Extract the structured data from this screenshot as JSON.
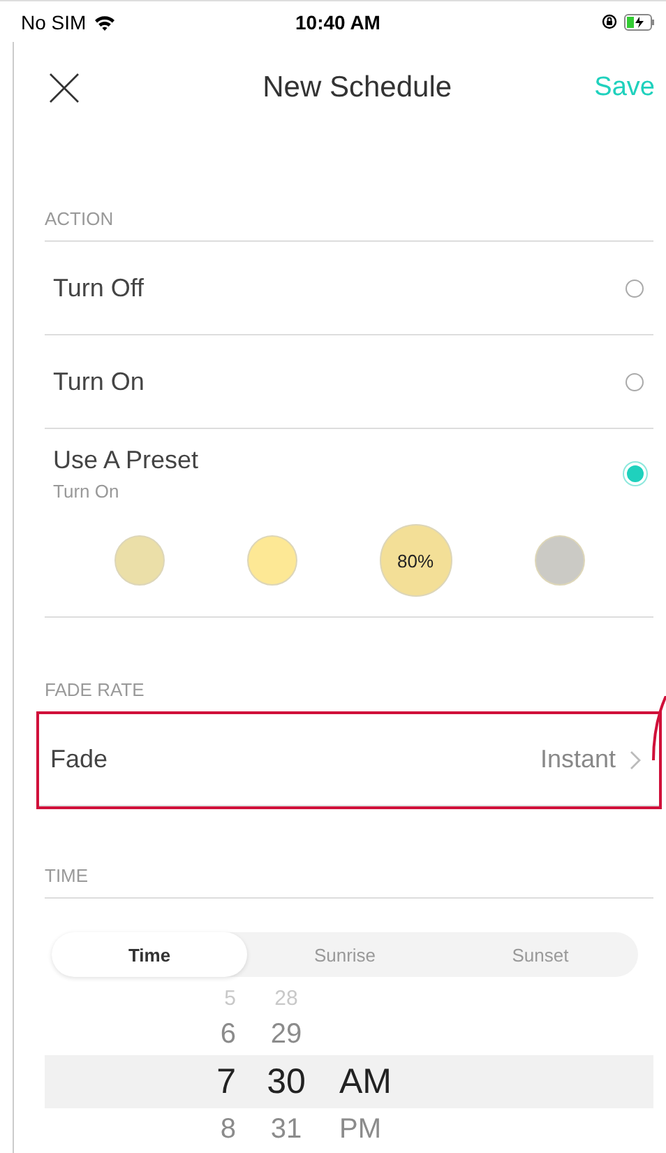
{
  "status_bar": {
    "carrier": "No SIM",
    "time": "10:40 AM"
  },
  "header": {
    "title": "New Schedule",
    "save": "Save"
  },
  "action": {
    "label": "ACTION",
    "options": [
      {
        "label": "Turn Off",
        "selected": false
      },
      {
        "label": "Turn On",
        "selected": false
      },
      {
        "label": "Use A Preset",
        "sublabel": "Turn On",
        "selected": true
      }
    ],
    "presets": [
      {
        "color": "#ebdfa8",
        "selected": false
      },
      {
        "color": "#fde895",
        "selected": false
      },
      {
        "color": "#f3df97",
        "label": "80%",
        "selected": true
      },
      {
        "color": "#cbcac5",
        "selected": false
      }
    ]
  },
  "fade_rate": {
    "label": "FADE RATE",
    "row": {
      "label": "Fade",
      "value": "Instant",
      "highlighted": true
    }
  },
  "time": {
    "label": "TIME",
    "tabs": [
      {
        "label": "Time",
        "selected": true
      },
      {
        "label": "Sunrise",
        "selected": false
      },
      {
        "label": "Sunset",
        "selected": false
      }
    ],
    "picker": [
      {
        "hour": "5",
        "minute": "28",
        "selected": false
      },
      {
        "hour": "6",
        "minute": "29",
        "selected": false
      },
      {
        "hour": "7",
        "minute": "30",
        "period": "AM",
        "selected": true
      },
      {
        "hour": "8",
        "minute": "31",
        "period": "PM",
        "selected": false
      }
    ]
  }
}
